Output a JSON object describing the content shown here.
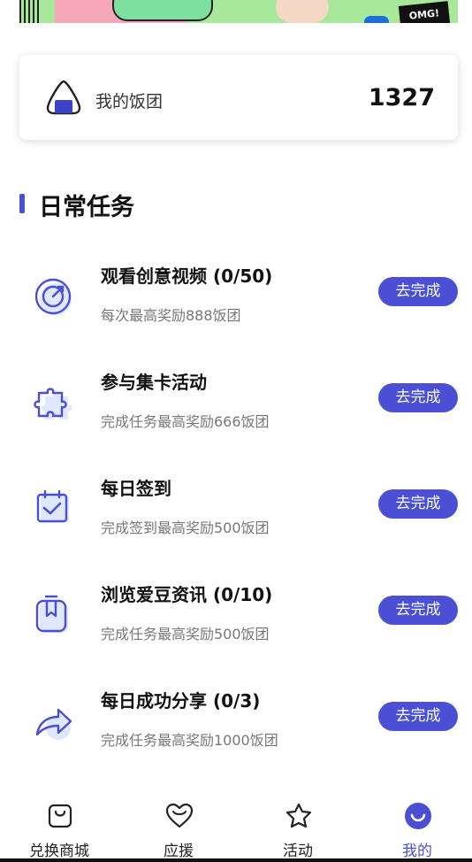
{
  "header": {
    "balance_label": "我的饭团",
    "balance_value": "1327",
    "banner_tag": "OMG!"
  },
  "section": {
    "title": "日常任务"
  },
  "tasks": [
    {
      "title": "观看创意视频 (0/50)",
      "desc": "每次最高奖励888饭团",
      "button": "去完成",
      "icon": "target-icon"
    },
    {
      "title": "参与集卡活动",
      "desc": "完成任务最高奖励666饭团",
      "button": "去完成",
      "icon": "puzzle-icon"
    },
    {
      "title": "每日签到",
      "desc": "完成签到最高奖励500饭团",
      "button": "去完成",
      "icon": "calendar-check-icon"
    },
    {
      "title": "浏览爱豆资讯 (0/10)",
      "desc": "完成任务最高奖励500饭团",
      "button": "去完成",
      "icon": "bookmark-icon"
    },
    {
      "title": "每日成功分享 (0/3)",
      "desc": "完成任务最高奖励1000饭团",
      "button": "去完成",
      "icon": "share-arrow-icon"
    }
  ],
  "tabs": [
    {
      "label": "兑换商城",
      "icon": "shopping-bag-icon",
      "active": false
    },
    {
      "label": "应援",
      "icon": "heart-icon",
      "active": false
    },
    {
      "label": "活动",
      "icon": "star-icon",
      "active": false
    },
    {
      "label": "我的",
      "icon": "smile-icon",
      "active": true
    }
  ],
  "colors": {
    "accent": "#4a4fd6",
    "text": "#111111",
    "muted": "#777777"
  }
}
